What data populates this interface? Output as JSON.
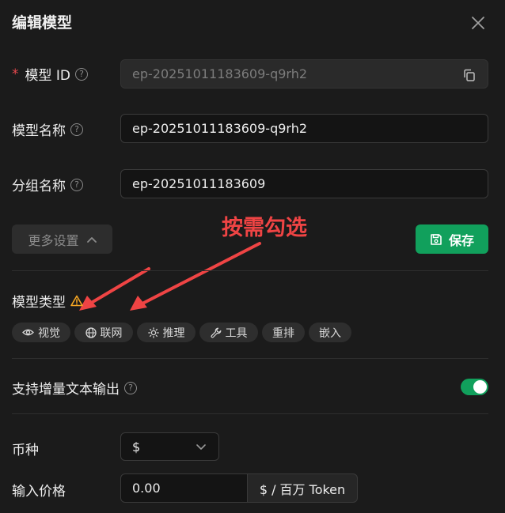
{
  "dialog": {
    "title": "编辑模型"
  },
  "form": {
    "model_id": {
      "label": "模型 ID",
      "required_mark": "*",
      "value": "ep-20251011183609-q9rh2"
    },
    "model_name": {
      "label": "模型名称",
      "value": "ep-20251011183609-q9rh2"
    },
    "group_name": {
      "label": "分组名称",
      "value": "ep-20251011183609"
    },
    "more_settings_label": "更多设置",
    "save_label": "保存",
    "model_type": {
      "label": "模型类型",
      "tags": [
        {
          "label": "视觉",
          "icon": "eye-icon"
        },
        {
          "label": "联网",
          "icon": "globe-icon"
        },
        {
          "label": "推理",
          "icon": "sun-icon"
        },
        {
          "label": "工具",
          "icon": "wrench-icon"
        },
        {
          "label": "重排"
        },
        {
          "label": "嵌入"
        }
      ]
    },
    "streaming": {
      "label": "支持增量文本输出",
      "enabled": true
    },
    "currency": {
      "label": "币种",
      "value": "$"
    },
    "input_price": {
      "label": "输入价格",
      "value": "0.00",
      "unit": "$ / 百万 Token"
    }
  },
  "annotation": {
    "text": "按需勾选"
  },
  "colors": {
    "accent": "#11a05c",
    "warning": "#f5a623",
    "annotation": "#ef4444"
  }
}
